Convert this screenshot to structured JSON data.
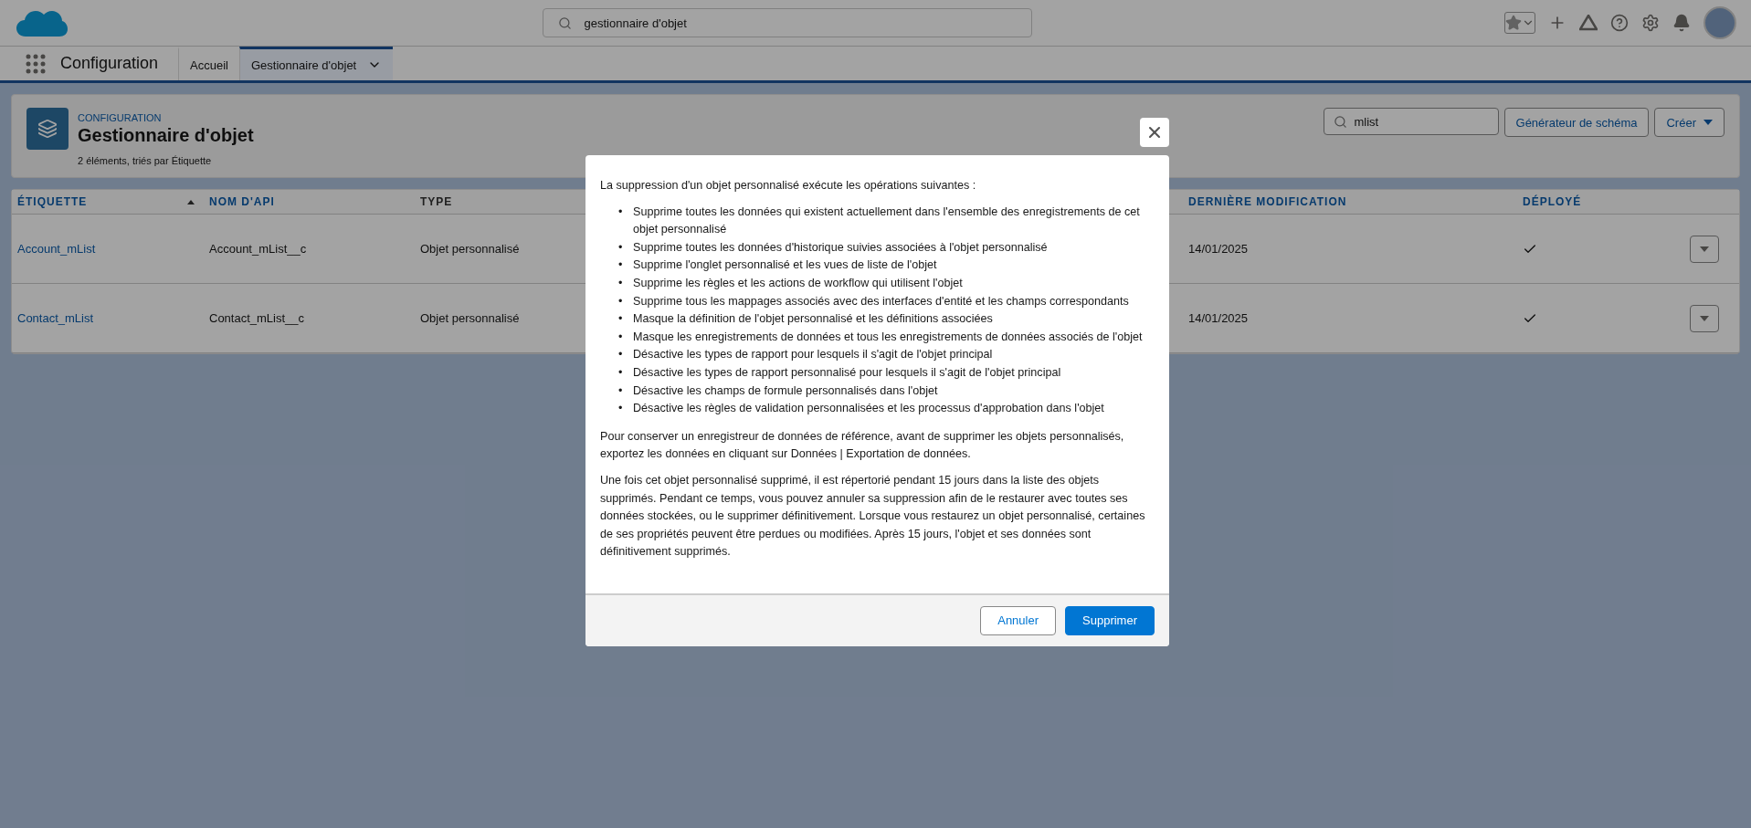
{
  "global_search": {
    "value": "gestionnaire d'objet"
  },
  "app_name": "Configuration",
  "tabs": [
    {
      "label": "Accueil",
      "selected": false,
      "has_menu": false
    },
    {
      "label": "Gestionnaire d'objet",
      "selected": true,
      "has_menu": true
    }
  ],
  "header": {
    "eyebrow": "CONFIGURATION",
    "title": "Gestionnaire d'objet",
    "subtitle": "2 éléments, triés par Étiquette",
    "search": {
      "value": "mlist"
    },
    "buttons": [
      {
        "label": "Générateur de schéma",
        "kind": "plain"
      },
      {
        "label": "Créer",
        "kind": "menu"
      }
    ]
  },
  "table": {
    "columns": [
      {
        "label": "ÉTIQUETTE",
        "sorted": true
      },
      {
        "label": "NOM D'API",
        "sorted": false
      },
      {
        "label": "TYPE",
        "sorted": false
      },
      {
        "label": "DERNIÈRE MODIFICATION",
        "sorted": false
      },
      {
        "label": "DÉPLOYÉ",
        "sorted": false
      }
    ],
    "rows": [
      {
        "label": "Account_mList",
        "api_name": "Account_mList__c",
        "type": "Objet personnalisé",
        "modified": "14/01/2025",
        "deployed": true
      },
      {
        "label": "Contact_mList",
        "api_name": "Contact_mList__c",
        "type": "Objet personnalisé",
        "modified": "14/01/2025",
        "deployed": true
      }
    ]
  },
  "modal": {
    "intro": "La suppression d'un objet personnalisé exécute les opérations suivantes :",
    "bullets": [
      {
        "marker": "•",
        "text": "Supprime toutes les données qui existent actuellement dans l'ensemble des enregistrements de cet objet personnalisé"
      },
      {
        "marker": "•",
        "text": "Supprime toutes les données d'historique suivies associées à l'objet personnalisé"
      },
      {
        "marker": "•",
        "text": "Supprime l'onglet personnalisé et les vues de liste de l'objet"
      },
      {
        "marker": "•",
        "text": "Supprime les règles et les actions de workflow qui utilisent l'objet"
      },
      {
        "marker": "•",
        "text": "Supprime tous les mappages associés avec des interfaces d'entité et les champs correspondants"
      },
      {
        "marker": "•",
        "text": "Masque la définition de l'objet personnalisé et les définitions associées"
      },
      {
        "marker": "•",
        "text": "Masque les enregistrements de données et tous les enregistrements de données associés de l'objet"
      },
      {
        "marker": "•",
        "text": "Désactive les types de rapport pour lesquels il s'agit de l'objet principal"
      },
      {
        "marker": "•",
        "text": "Désactive les types de rapport personnalisé pour lesquels il s'agit de l'objet principal"
      },
      {
        "marker": "•",
        "text": "Désactive les champs de formule personnalisés dans l'objet"
      },
      {
        "marker": "•",
        "text": "Désactive les règles de validation personnalisées et les processus d'approbation dans l'objet"
      }
    ],
    "paragraphs": [
      "Pour conserver un enregistreur de données de référence, avant de supprimer les objets personnalisés, exportez les données en cliquant sur Données | Exportation de données.",
      "Une fois cet objet personnalisé supprimé, il est répertorié pendant 15 jours dans la liste des objets supprimés. Pendant ce temps, vous pouvez annuler sa suppression afin de le restaurer avec toutes ses données stockées, ou le supprimer définitivement. Lorsque vous restaurez un objet personnalisé, certaines de ses propriétés peuvent être perdues ou modifiées. Après 15 jours, l'objet et ses données sont définitivement supprimés."
    ],
    "buttons": [
      {
        "label": "Annuler",
        "kind": "neutral"
      },
      {
        "label": "Supprimer",
        "kind": "brand"
      }
    ]
  }
}
